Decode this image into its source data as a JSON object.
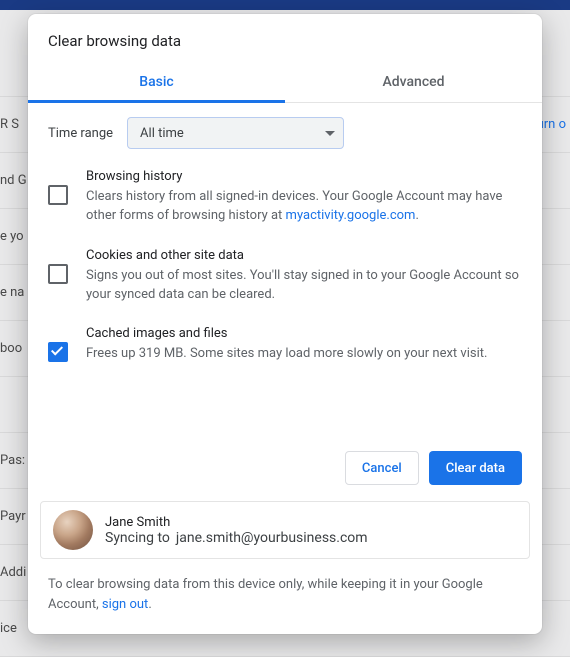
{
  "background": {
    "rows": [
      {
        "label": "R S",
        "right": "Turn o"
      },
      {
        "label": "nd G"
      },
      {
        "label": "e yo"
      },
      {
        "label": "e na"
      },
      {
        "label": "boo"
      },
      {
        "label": ""
      },
      {
        "label": "Pas:"
      },
      {
        "label": "Payr"
      },
      {
        "label": "Addi"
      },
      {
        "label": "ice"
      }
    ]
  },
  "dialog": {
    "title": "Clear browsing data",
    "tabs": {
      "basic": "Basic",
      "advanced": "Advanced",
      "active": "basic"
    },
    "time_range": {
      "label": "Time range",
      "value": "All time"
    },
    "options": [
      {
        "checked": false,
        "title": "Browsing history",
        "desc_pre": "Clears history from all signed-in devices. Your Google Account may have other forms of browsing history at ",
        "link": "myactivity.google.com",
        "desc_post": "."
      },
      {
        "checked": false,
        "title": "Cookies and other site data",
        "desc_pre": "Signs you out of most sites. You'll stay signed in to your Google Account so your synced data can be cleared.",
        "link": "",
        "desc_post": ""
      },
      {
        "checked": true,
        "title": "Cached images and files",
        "desc_pre": "Frees up 319 MB. Some sites may load more slowly on your next visit.",
        "link": "",
        "desc_post": ""
      }
    ],
    "buttons": {
      "cancel": "Cancel",
      "confirm": "Clear data"
    },
    "account": {
      "name": "Jane Smith",
      "sync_label": "Syncing to",
      "email": "jane.smith@yourbusiness.com"
    },
    "footer": {
      "pre": "To clear browsing data from this device only, while keeping it in your Google Account, ",
      "link": "sign out",
      "post": "."
    }
  }
}
